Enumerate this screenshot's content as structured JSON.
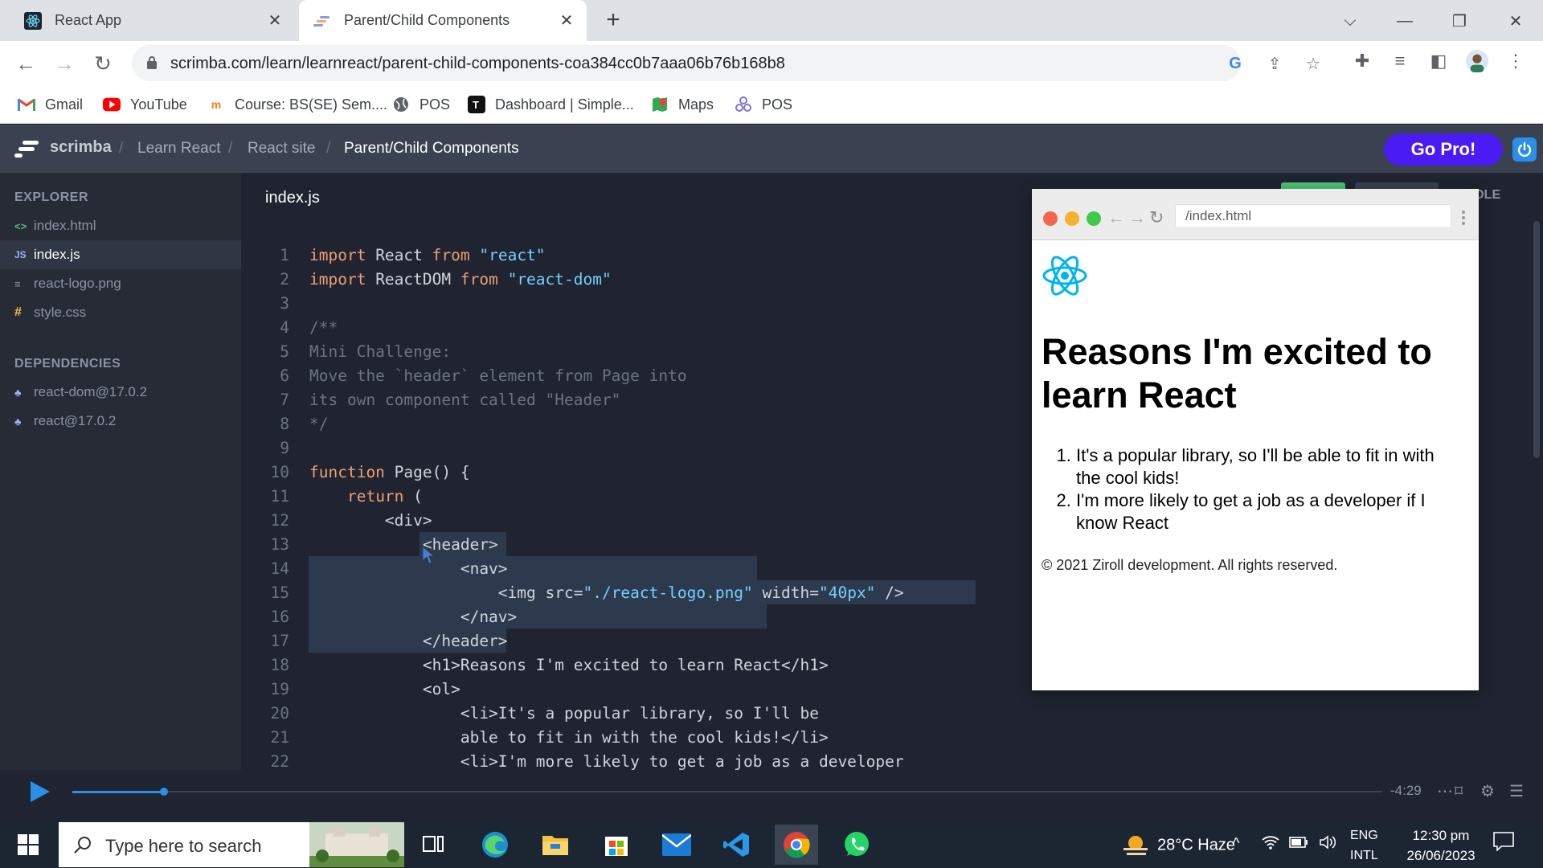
{
  "browser": {
    "tabs": [
      {
        "title": "React App"
      },
      {
        "title": "Parent/Child Components"
      }
    ],
    "url": "scrimba.com/learn/learnreact/parent-child-components-coa384cc0b7aaa06b76b168b8",
    "bookmarks": [
      {
        "label": "Gmail",
        "icon": "gmail-icon"
      },
      {
        "label": "YouTube",
        "icon": "youtube-icon"
      },
      {
        "label": "Course: BS(SE) Sem....",
        "icon": "moodle-icon"
      },
      {
        "label": "POS",
        "icon": "globe-icon"
      },
      {
        "label": "Dashboard | Simple...",
        "icon": "dashboard-icon"
      },
      {
        "label": "Maps",
        "icon": "maps-icon"
      },
      {
        "label": "POS",
        "icon": "pos-icon"
      }
    ]
  },
  "scrimba": {
    "brand": "scrimba",
    "breadcrumbs": [
      "Learn React",
      "React site",
      "Parent/Child Components"
    ],
    "go_pro": "Go Pro!"
  },
  "sidebar": {
    "explorer_title": "EXPLORER",
    "files": [
      {
        "icon": "<>",
        "name": "index.html"
      },
      {
        "icon": "JS",
        "name": "index.js"
      },
      {
        "icon": "≡",
        "name": "react-logo.png"
      },
      {
        "icon": "#",
        "name": "style.css"
      }
    ],
    "dependencies_title": "DEPENDENCIES",
    "dependencies": [
      "react-dom@17.0.2",
      "react@17.0.2"
    ]
  },
  "editor": {
    "file_title": "index.js",
    "line_numbers": [
      "1",
      "2",
      "3",
      "4",
      "5",
      "6",
      "7",
      "8",
      "9",
      "10",
      "11",
      "12",
      "13",
      "14",
      "15",
      "16",
      "17",
      "18",
      "19",
      "20",
      "21",
      "22"
    ]
  },
  "preview": {
    "url": "/index.html",
    "heading": "Reasons I'm excited to learn React",
    "list": [
      "It's a popular library, so I'll be able to fit in with the cool kids!",
      "I'm more likely to get a job as a developer if I know React"
    ],
    "footer": "© 2021 Ziroll development. All rights reserved.",
    "console_label": "NSOLE"
  },
  "player": {
    "time": "-4:29",
    "progress": 0.07
  },
  "taskbar": {
    "search_placeholder": "Type here to search",
    "weather": "28°C  Haze",
    "lang_top": "ENG",
    "lang_bottom": "INTL",
    "time": "12:30 pm",
    "date": "26/06/2023"
  },
  "colors": {
    "accent": "#4a1cf3",
    "power": "#2b8fe8",
    "editor_bg": "#1f2430",
    "string": "#bae67e",
    "keyword": "#f29e74"
  }
}
